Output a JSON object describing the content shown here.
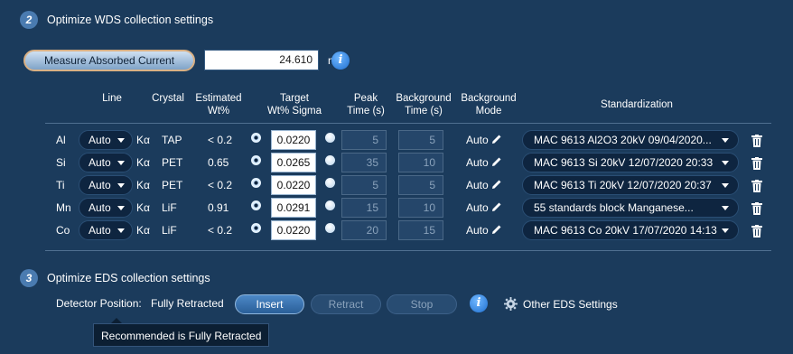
{
  "wds_section": {
    "step_number": "2",
    "title": "Optimize WDS collection settings",
    "measure_button_label": "Measure Absorbed Current",
    "current_value": "24.610",
    "current_unit": "nA",
    "info_label": "i",
    "headers": {
      "line": "Line",
      "crystal": "Crystal",
      "estimated": "Estimated\nWt%",
      "target": "Target\nWt% Sigma",
      "peak": "Peak\nTime (s)",
      "background_time": "Background\nTime (s)",
      "background_mode": "Background\nMode",
      "standardization": "Standardization"
    },
    "rows": [
      {
        "element": "Al",
        "line": "Auto",
        "line_type": "Kα",
        "crystal": "TAP",
        "estimated": "< 0.2",
        "sigma": "0.0220",
        "peak": "5",
        "background": "5",
        "mode": "Auto",
        "standard": "MAC 9613 Al2O3 20kV 09/04/2020..."
      },
      {
        "element": "Si",
        "line": "Auto",
        "line_type": "Kα",
        "crystal": "PET",
        "estimated": "0.65",
        "sigma": "0.0265",
        "peak": "35",
        "background": "10",
        "mode": "Auto",
        "standard": "MAC 9613 Si 20kV 12/07/2020 20:33"
      },
      {
        "element": "Ti",
        "line": "Auto",
        "line_type": "Kα",
        "crystal": "PET",
        "estimated": "< 0.2",
        "sigma": "0.0220",
        "peak": "5",
        "background": "5",
        "mode": "Auto",
        "standard": "MAC 9613 Ti 20kV 12/07/2020 20:37"
      },
      {
        "element": "Mn",
        "line": "Auto",
        "line_type": "Kα",
        "crystal": "LiF",
        "estimated": "0.91",
        "sigma": "0.0291",
        "peak": "15",
        "background": "10",
        "mode": "Auto",
        "standard": "55 standards block  Manganese..."
      },
      {
        "element": "Co",
        "line": "Auto",
        "line_type": "Kα",
        "crystal": "LiF",
        "estimated": "< 0.2",
        "sigma": "0.0220",
        "peak": "20",
        "background": "15",
        "mode": "Auto",
        "standard": "MAC 9613 Co 20kV 17/07/2020 14:13"
      }
    ]
  },
  "eds_section": {
    "step_number": "3",
    "title": "Optimize EDS collection settings",
    "detector_label": "Detector Position:",
    "detector_value": "Fully Retracted",
    "insert_label": "Insert",
    "retract_label": "Retract",
    "stop_label": "Stop",
    "info_label": "i",
    "other_settings_label": "Other EDS Settings",
    "tooltip": "Recommended is Fully Retracted"
  },
  "colors": {
    "background": "#1b3b5c",
    "accent": "#4a7bb0",
    "info": "#1f6fd0"
  },
  "icons": [
    "info-icon",
    "pencil-icon",
    "trash-icon",
    "gear-icon",
    "chevron-down-icon"
  ]
}
